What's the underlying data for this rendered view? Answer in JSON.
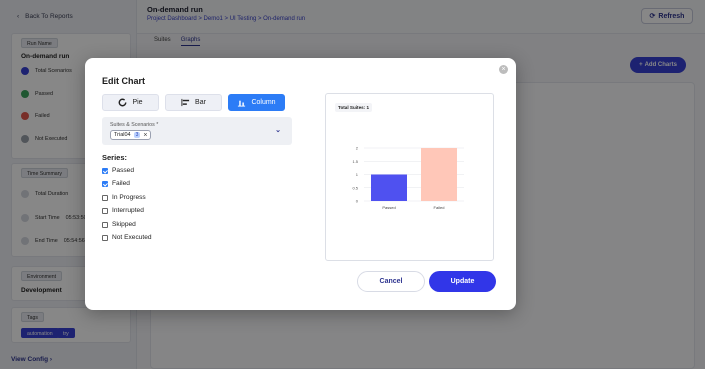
{
  "colors": {
    "accent": "#3136e8",
    "active_type": "#2c7cf6",
    "bar_passed": "#4f51f0",
    "bar_failed": "#ffc7b8",
    "status_passed": "#3ba55d",
    "status_failed": "#e2574c",
    "status_total": "#3740d6",
    "status_not_executed": "#9aa0aa"
  },
  "sidebar": {
    "back_label": "Back To Reports",
    "run_name_chip": "Run Name",
    "run_name": "On-demand run",
    "stats": [
      {
        "label": "Total Scenarios",
        "icon": "total-icon"
      },
      {
        "label": "Passed",
        "icon": "passed-icon"
      },
      {
        "label": "Failed",
        "icon": "failed-icon"
      },
      {
        "label": "Not Executed",
        "icon": "not-executed-icon"
      }
    ],
    "time_summary_chip": "Time Summary",
    "time_rows": [
      {
        "label": "Total Duration",
        "value": ""
      },
      {
        "label": "Start Time",
        "value": "05:53:50"
      },
      {
        "label": "End Time",
        "value": "05:54:56"
      }
    ],
    "environment_chip": "Environment",
    "environment": "Development",
    "tags_chip": "Tags",
    "tags": [
      "automation",
      "try"
    ],
    "view_config": "View Config"
  },
  "header": {
    "title": "On-demand run",
    "breadcrumb": "Project Dashboard  >  Demo1  >  UI Testing  >  On-demand run",
    "refresh_label": "Refresh",
    "tabs": [
      "Suites",
      "Graphs"
    ],
    "add_charts_label": "Add Charts"
  },
  "modal": {
    "title": "Edit Chart",
    "chart_types": [
      {
        "label": "Pie",
        "icon": "pie-icon"
      },
      {
        "label": "Bar",
        "icon": "bar-icon"
      },
      {
        "label": "Column",
        "icon": "column-icon"
      }
    ],
    "selected_type": "Column",
    "suites_label": "Suites & Scenarios *",
    "selected_suite": "Trial04",
    "selected_suite_count": "3",
    "series_title": "Series:",
    "series": [
      {
        "label": "Passed",
        "checked": true
      },
      {
        "label": "Failed",
        "checked": true
      },
      {
        "label": "In Progress",
        "checked": false
      },
      {
        "label": "Interrupted",
        "checked": false
      },
      {
        "label": "Skipped",
        "checked": false
      },
      {
        "label": "Not Executed",
        "checked": false
      }
    ],
    "preview_title": "Total Suites: 1",
    "cancel_label": "Cancel",
    "update_label": "Update"
  },
  "chart_data": {
    "type": "bar",
    "categories": [
      "Passed",
      "Failed"
    ],
    "values": [
      1,
      2
    ],
    "yticks": [
      "0",
      "0.5",
      "1",
      "1.5",
      "2"
    ],
    "ylim": [
      0,
      2
    ],
    "title": "Total Suites: 1",
    "grid": true
  }
}
